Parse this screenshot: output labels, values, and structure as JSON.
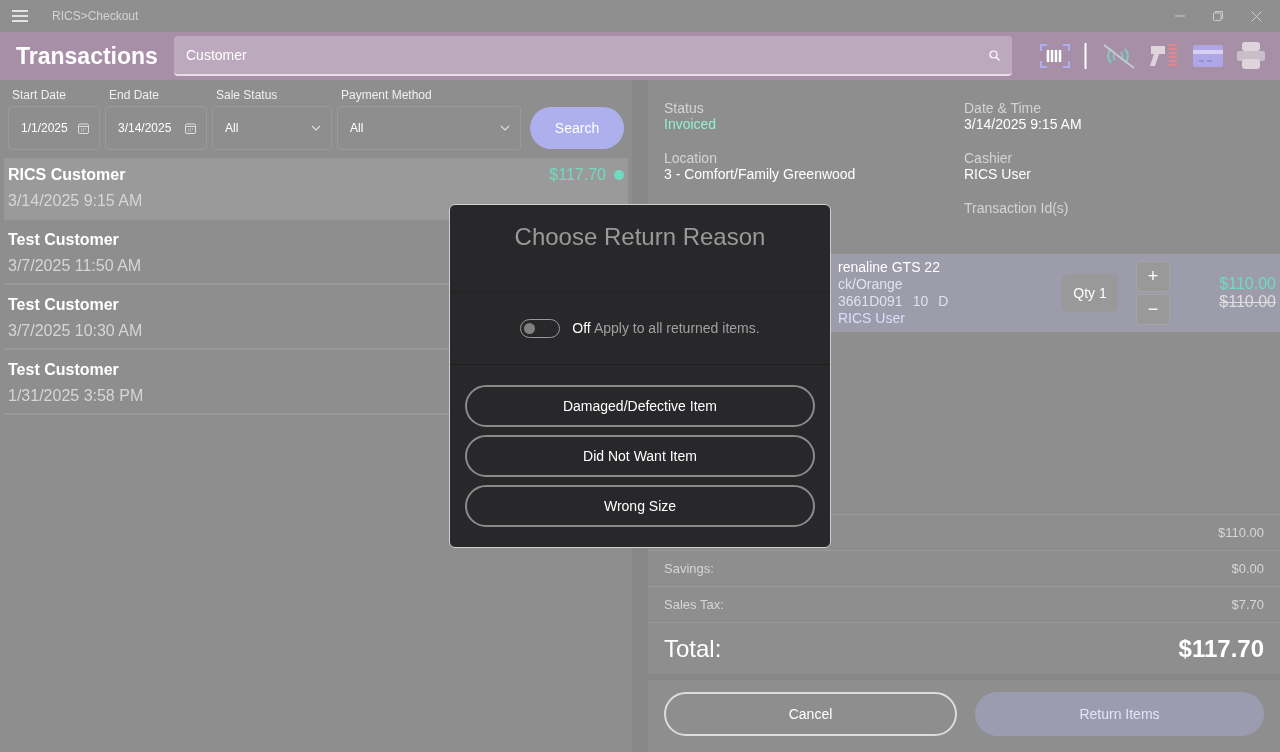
{
  "window": {
    "title": "RICS>Checkout"
  },
  "header": {
    "title": "Transactions",
    "search": {
      "value": "Customer"
    }
  },
  "filters": [
    {
      "label": "Start Date",
      "value": "1/1/2025",
      "kind": "date"
    },
    {
      "label": "End Date",
      "value": "3/14/2025",
      "kind": "date"
    },
    {
      "label": "Sale Status",
      "value": "All",
      "kind": "select"
    },
    {
      "label": "Payment Method",
      "value": "All",
      "kind": "select"
    }
  ],
  "search_button": "Search",
  "transactions": [
    {
      "customer": "RICS Customer",
      "date": "3/14/2025 9:15 AM",
      "amount": "$117.70",
      "selected": true,
      "color": "#6fdcc0"
    },
    {
      "customer": "Test Customer",
      "date": "3/7/2025 11:50 AM",
      "selected": false
    },
    {
      "customer": "Test Customer",
      "date": "3/7/2025 10:30 AM",
      "selected": false
    },
    {
      "customer": "Test Customer",
      "date": "1/31/2025 3:58 PM",
      "selected": false
    }
  ],
  "details": [
    {
      "label": "Status",
      "value": "Invoiced",
      "kind": "status"
    },
    {
      "label": "Date & Time",
      "value": "3/14/2025 9:15 AM",
      "kind": "plain"
    },
    {
      "label": "Location",
      "value": "3 - Comfort/Family Greenwood",
      "kind": "plain"
    },
    {
      "label": "Cashier",
      "value": "RICS User",
      "kind": "plain"
    },
    {
      "label": "Transaction Id(s)",
      "kind": "id"
    }
  ],
  "line_item": {
    "name": "renaline GTS 22",
    "color_name": "ck/Orange",
    "sku": "3661D091",
    "size": "10",
    "width": "D",
    "salesperson": "RICS User",
    "qty": "Qty 1",
    "plus": "+",
    "minus": "−",
    "price": "$110.00",
    "original_price": "$110.00"
  },
  "totals": [
    {
      "value": "$110.00"
    },
    {
      "label": "Savings:",
      "value": "$0.00"
    },
    {
      "label": "Sales Tax:",
      "value": "$7.70"
    }
  ],
  "total": {
    "label": "Total:",
    "value": "$117.70"
  },
  "actions": [
    {
      "label": "Cancel",
      "kind": "outline"
    },
    {
      "label": "Return Items",
      "kind": "filled"
    }
  ],
  "dialog": {
    "title": "Choose Return Reason",
    "toggle": {
      "on": false,
      "state_label": "Off",
      "label": "Apply to all returned items."
    },
    "reasons": [
      "Damaged/Defective Item",
      "Did Not Want Item",
      "Wrong Size"
    ]
  }
}
